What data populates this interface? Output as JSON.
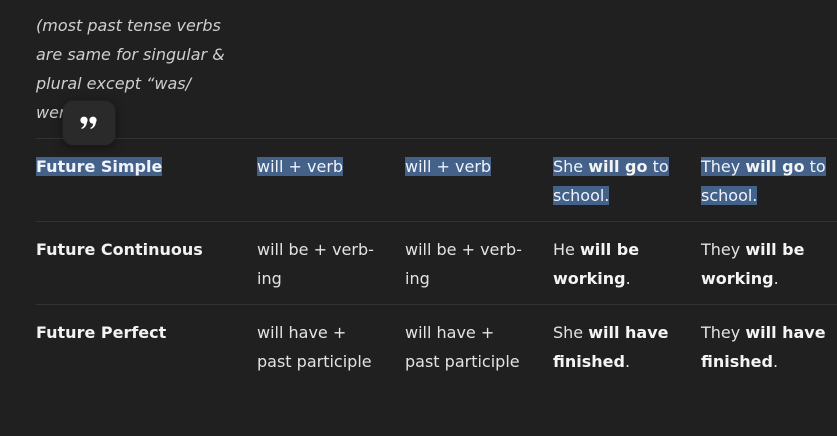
{
  "note": {
    "lines": [
      "(most past tense verbs",
      "are same for singular &",
      "plural except “was/",
      "were”)"
    ]
  },
  "quote_button": {
    "icon": "quote-icon"
  },
  "rows": [
    {
      "tense": "Future Simple",
      "col1": "will + verb",
      "col2": "will + verb",
      "ex1": {
        "pre": "She ",
        "bold": "will go",
        "post": " to school."
      },
      "ex2": {
        "pre": "They ",
        "bold": "will go",
        "post": " to school."
      },
      "selected": true
    },
    {
      "tense": "Future Continuous",
      "col1": "will be + verb-ing",
      "col2": "will be + verb-ing",
      "ex1": {
        "pre": "He ",
        "bold": "will be working",
        "post": "."
      },
      "ex2": {
        "pre": "They ",
        "bold": "will be working",
        "post": "."
      },
      "selected": false
    },
    {
      "tense": "Future Perfect",
      "col1": "will have + past participle",
      "col2": "will have + past participle",
      "ex1": {
        "pre": "She ",
        "bold": "will have finished",
        "post": "."
      },
      "ex2": {
        "pre": "They ",
        "bold": "will have finished",
        "post": "."
      },
      "selected": false
    }
  ],
  "colors": {
    "background": "#202020",
    "selection": "#44618a",
    "divider": "#333333"
  }
}
